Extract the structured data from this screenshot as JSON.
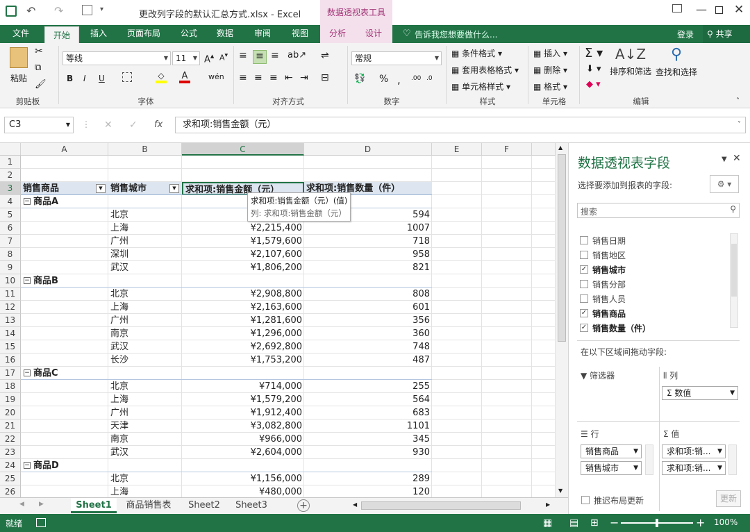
{
  "window": {
    "title": "更改列字段的默认汇总方式.xlsx - Excel",
    "context_tab_header": "数据透视表工具"
  },
  "tabs": [
    "文件",
    "开始",
    "插入",
    "页面布局",
    "公式",
    "数据",
    "审阅",
    "视图",
    "分析",
    "设计"
  ],
  "tell_me": "告诉我您想要做什么...",
  "login": "登录",
  "share": "共享",
  "ribbon": {
    "paste": "粘贴",
    "clipboard": "剪贴板",
    "font_name": "等线",
    "font_size": "11",
    "font_group": "字体",
    "bold": "B",
    "italic": "I",
    "underline": "U",
    "align_group": "对齐方式",
    "num_format": "常规",
    "num_group": "数字",
    "percent": "%",
    "cond_format": "条件格式",
    "table_format": "套用表格格式",
    "cell_style": "单元格样式",
    "style_group": "样式",
    "insert": "插入",
    "delete": "删除",
    "format": "格式",
    "cells_group": "单元格",
    "sort": "排序和筛选",
    "find": "查找和选择",
    "edit_group": "编辑"
  },
  "formula_bar": {
    "name_box": "C3",
    "content": "求和项:销售金额（元）"
  },
  "columns": [
    "A",
    "B",
    "C",
    "D",
    "E",
    "F"
  ],
  "rows": [
    "1",
    "2",
    "3",
    "4",
    "5",
    "6",
    "7",
    "8",
    "9",
    "10",
    "11",
    "12",
    "13",
    "14",
    "15",
    "16",
    "17",
    "18",
    "19",
    "20",
    "21",
    "22",
    "23",
    "24",
    "25",
    "26"
  ],
  "pivot": {
    "headers": [
      "销售商品",
      "销售城市",
      "求和项:销售金额（元）",
      "求和项:销售数量（件）"
    ],
    "groups": [
      {
        "label": "商品A",
        "rows": [
          [
            "北京",
            "",
            "594"
          ],
          [
            "上海",
            "¥2,215,400",
            "1007"
          ],
          [
            "广州",
            "¥1,579,600",
            "718"
          ],
          [
            "深圳",
            "¥2,107,600",
            "958"
          ],
          [
            "武汉",
            "¥1,806,200",
            "821"
          ]
        ]
      },
      {
        "label": "商品B",
        "rows": [
          [
            "北京",
            "¥2,908,800",
            "808"
          ],
          [
            "上海",
            "¥2,163,600",
            "601"
          ],
          [
            "广州",
            "¥1,281,600",
            "356"
          ],
          [
            "南京",
            "¥1,296,000",
            "360"
          ],
          [
            "武汉",
            "¥2,692,800",
            "748"
          ],
          [
            "长沙",
            "¥1,753,200",
            "487"
          ]
        ]
      },
      {
        "label": "商品C",
        "rows": [
          [
            "北京",
            "¥714,000",
            "255"
          ],
          [
            "上海",
            "¥1,579,200",
            "564"
          ],
          [
            "广州",
            "¥1,912,400",
            "683"
          ],
          [
            "天津",
            "¥3,082,800",
            "1101"
          ],
          [
            "南京",
            "¥966,000",
            "345"
          ],
          [
            "武汉",
            "¥2,604,000",
            "930"
          ]
        ]
      },
      {
        "label": "商品D",
        "rows": [
          [
            "北京",
            "¥1,156,000",
            "289"
          ],
          [
            "上海",
            "¥480,000",
            "120"
          ]
        ]
      }
    ]
  },
  "tooltip": {
    "line1": "求和项:销售金额（元）(值)",
    "line2": "列: 求和项:销售金额（元）"
  },
  "sheet_tabs": [
    "Sheet1",
    "商品销售表",
    "Sheet2",
    "Sheet3"
  ],
  "status": {
    "ready": "就绪",
    "zoom": "100%"
  },
  "pane": {
    "title": "数据透视表字段",
    "subtitle": "选择要添加到报表的字段:",
    "search": "搜索",
    "fields": [
      {
        "name": "销售日期",
        "checked": false
      },
      {
        "name": "销售地区",
        "checked": false
      },
      {
        "name": "销售城市",
        "checked": true
      },
      {
        "name": "销售分部",
        "checked": false
      },
      {
        "name": "销售人员",
        "checked": false
      },
      {
        "name": "销售商品",
        "checked": true
      },
      {
        "name": "销售数量（件）",
        "checked": true
      }
    ],
    "drag_label": "在以下区域间拖动字段:",
    "filter": "筛选器",
    "columns": "列",
    "rows": "行",
    "values": "值",
    "col_chip": "Σ 数值",
    "row_chips": [
      "销售商品",
      "销售城市"
    ],
    "val_chips": [
      "求和项:销...",
      "求和项:销..."
    ],
    "defer": "推迟布局更新",
    "update": "更新"
  },
  "colors": {
    "green": "#217346",
    "context": "#a33577"
  }
}
